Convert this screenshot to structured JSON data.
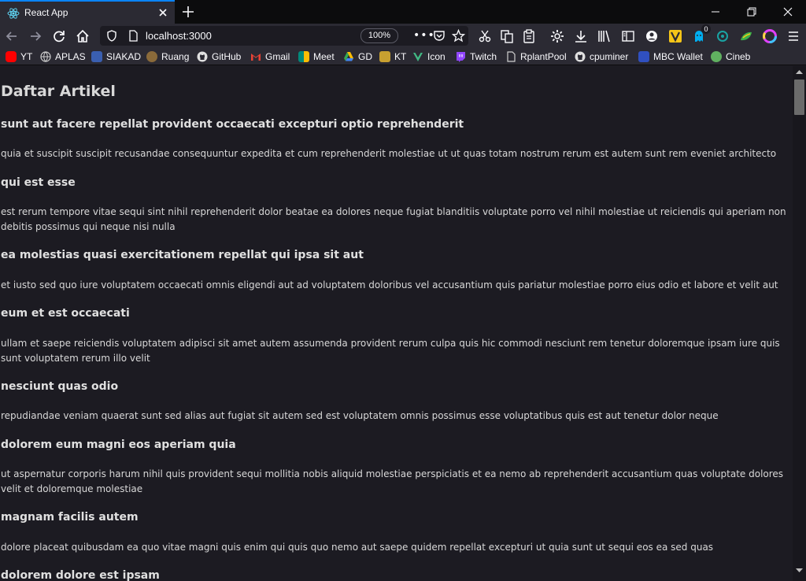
{
  "browser": {
    "tab_title": "React App",
    "url": "localhost:3000",
    "zoom": "100%",
    "extension_badge": "0"
  },
  "bookmarks": [
    {
      "label": "YT",
      "icon": "youtube-icon",
      "color": "#ff0000"
    },
    {
      "label": "APLAS",
      "icon": "globe-icon",
      "color": "#b0b0b0"
    },
    {
      "label": "SIAKAD",
      "icon": "siakad-logo-icon",
      "color": "#3a5fb0"
    },
    {
      "label": "Ruang",
      "icon": "ruang-logo-icon",
      "color": "#8a6a3a"
    },
    {
      "label": "GitHub",
      "icon": "github-icon",
      "color": "#e0e0e0"
    },
    {
      "label": "Gmail",
      "icon": "gmail-icon",
      "color": "#ea4335"
    },
    {
      "label": "Meet",
      "icon": "meet-icon",
      "color": "#00897b"
    },
    {
      "label": "GD",
      "icon": "google-drive-icon",
      "color": "#fbbc04"
    },
    {
      "label": "KT",
      "icon": "kt-logo-icon",
      "color": "#c8a030"
    },
    {
      "label": "Icon",
      "icon": "vue-icon",
      "color": "#41b883"
    },
    {
      "label": "Twitch",
      "icon": "twitch-icon",
      "color": "#9146ff"
    },
    {
      "label": "RplantPool",
      "icon": "rplantpool-icon",
      "color": "#d0d0d0"
    },
    {
      "label": "cpuminer",
      "icon": "github-icon",
      "color": "#e0e0e0"
    },
    {
      "label": "MBC Wallet",
      "icon": "mbc-wallet-icon",
      "color": "#3050c0"
    },
    {
      "label": "Cineb",
      "icon": "cineb-icon",
      "color": "#60b060"
    }
  ],
  "page": {
    "heading": "Daftar Artikel",
    "posts": [
      {
        "title": "sunt aut facere repellat provident occaecati excepturi optio reprehenderit",
        "body": "quia et suscipit suscipit recusandae consequuntur expedita et cum reprehenderit molestiae ut ut quas totam nostrum rerum est autem sunt rem eveniet architecto"
      },
      {
        "title": "qui est esse",
        "body": "est rerum tempore vitae sequi sint nihil reprehenderit dolor beatae ea dolores neque fugiat blanditiis voluptate porro vel nihil molestiae ut reiciendis qui aperiam non debitis possimus qui neque nisi nulla"
      },
      {
        "title": "ea molestias quasi exercitationem repellat qui ipsa sit aut",
        "body": "et iusto sed quo iure voluptatem occaecati omnis eligendi aut ad voluptatem doloribus vel accusantium quis pariatur molestiae porro eius odio et labore et velit aut"
      },
      {
        "title": "eum et est occaecati",
        "body": "ullam et saepe reiciendis voluptatem adipisci sit amet autem assumenda provident rerum culpa quis hic commodi nesciunt rem tenetur doloremque ipsam iure quis sunt voluptatem rerum illo velit"
      },
      {
        "title": "nesciunt quas odio",
        "body": "repudiandae veniam quaerat sunt sed alias aut fugiat sit autem sed est voluptatem omnis possimus esse voluptatibus quis est aut tenetur dolor neque"
      },
      {
        "title": "dolorem eum magni eos aperiam quia",
        "body": "ut aspernatur corporis harum nihil quis provident sequi mollitia nobis aliquid molestiae perspiciatis et ea nemo ab reprehenderit accusantium quas voluptate dolores velit et doloremque molestiae"
      },
      {
        "title": "magnam facilis autem",
        "body": "dolore placeat quibusdam ea quo vitae magni quis enim qui quis quo nemo aut saepe quidem repellat excepturi ut quia sunt ut sequi eos ea sed quas"
      },
      {
        "title": "dolorem dolore est ipsam",
        "body": ""
      }
    ]
  },
  "colors": {
    "tab_accent": "#0a84ff",
    "chrome_bg": "#2b2a33",
    "page_bg": "#1c1b22"
  }
}
